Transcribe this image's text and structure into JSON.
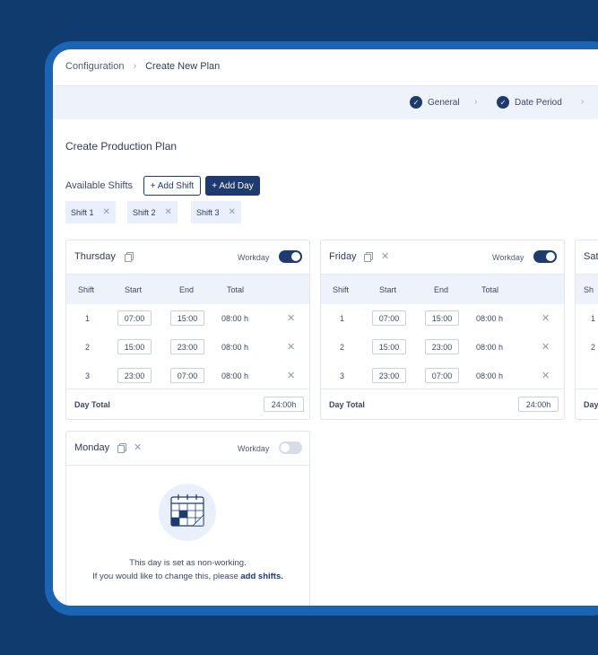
{
  "breadcrumb": [
    "Configuration",
    "Create New Plan"
  ],
  "steps": [
    "General",
    "Date Period"
  ],
  "page_title": "Create Production Plan",
  "shifts": {
    "label": "Available Shifts",
    "add_shift": "+ Add Shift",
    "add_day": "+ Add Day",
    "chips": [
      "Shift 1",
      "Shift 2",
      "Shift 3"
    ]
  },
  "table_headers": [
    "Shift",
    "Start",
    "End",
    "Total"
  ],
  "days": [
    {
      "name": "Thursday",
      "workday_label": "Workday",
      "workday": true,
      "rows": [
        {
          "shift": "1",
          "start": "07:00",
          "end": "15:00",
          "total": "08:00 h"
        },
        {
          "shift": "2",
          "start": "15:00",
          "end": "23:00",
          "total": "08:00 h"
        },
        {
          "shift": "3",
          "start": "23:00",
          "end": "07:00",
          "total": "08:00 h"
        }
      ],
      "day_total_label": "Day Total",
      "day_total": "24:00h"
    },
    {
      "name": "Friday",
      "workday_label": "Workday",
      "workday": true,
      "rows": [
        {
          "shift": "1",
          "start": "07:00",
          "end": "15:00",
          "total": "08:00 h"
        },
        {
          "shift": "2",
          "start": "15:00",
          "end": "23:00",
          "total": "08:00 h"
        },
        {
          "shift": "3",
          "start": "23:00",
          "end": "07:00",
          "total": "08:00 h"
        }
      ],
      "day_total_label": "Day Total",
      "day_total": "24:00h"
    },
    {
      "name": "Sat",
      "header_partial": "Sh",
      "rows_partial": [
        "1",
        "2"
      ],
      "day_total_label": "Day"
    },
    {
      "name": "Monday",
      "workday_label": "Workday",
      "workday": false,
      "empty_line1": "This day is set as non-working.",
      "empty_line2": "If you would like to change this, please ",
      "empty_link": "add shifts."
    }
  ],
  "icons": [
    "chevron-right-icon",
    "check-circle-icon",
    "copy-icon",
    "close-icon",
    "calendar-illustration-icon"
  ],
  "colors": {
    "primary": "#1e3a6e",
    "background": "#0f3b6f",
    "frame": "#1a64b3",
    "surface": "#ffffff",
    "band": "#eef2fa"
  }
}
